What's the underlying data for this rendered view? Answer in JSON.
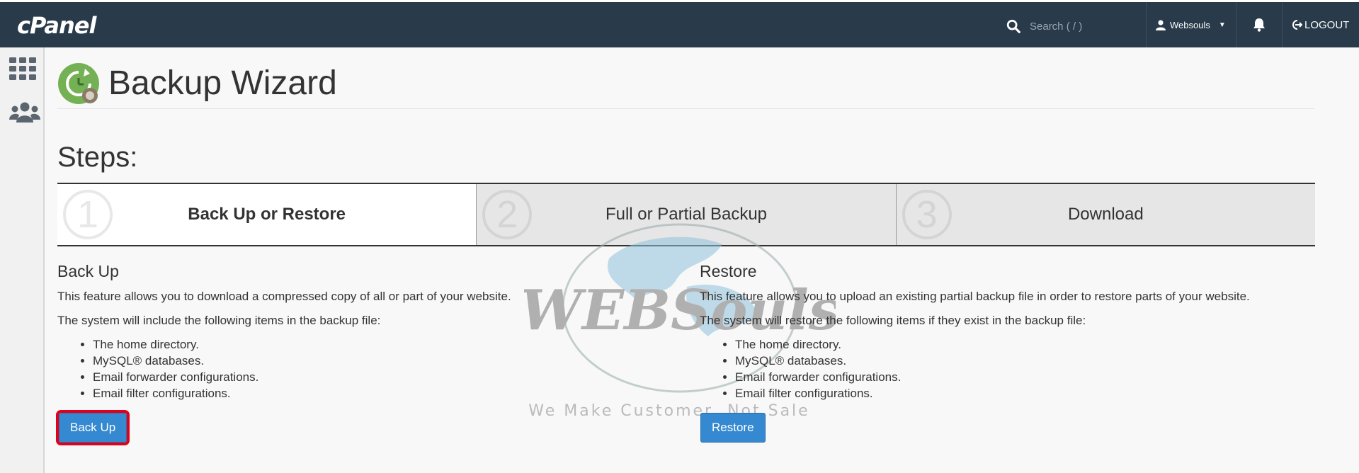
{
  "header": {
    "logo": "cPanel",
    "search_placeholder": "Search ( / )",
    "username": "Websouls",
    "logout_label": "LOGOUT"
  },
  "page": {
    "title": "Backup Wizard"
  },
  "steps": {
    "heading": "Steps:",
    "items": [
      {
        "number": "1",
        "label": "Back Up or Restore"
      },
      {
        "number": "2",
        "label": "Full or Partial Backup"
      },
      {
        "number": "3",
        "label": "Download"
      }
    ]
  },
  "backup": {
    "title": "Back Up",
    "desc": "This feature allows you to download a compressed copy of all or part of your website.",
    "includes_intro": "The system will include the following items in the backup file:",
    "items": [
      "The home directory.",
      "MySQL® databases.",
      "Email forwarder configurations.",
      "Email filter configurations."
    ],
    "button_label": "Back Up"
  },
  "restore": {
    "title": "Restore",
    "desc": "This feature allows you to upload an existing partial backup file in order to restore parts of your website.",
    "includes_intro": "The system will restore the following items if they exist in the backup file:",
    "items": [
      "The home directory.",
      "MySQL® databases.",
      "Email forwarder configurations.",
      "Email filter configurations."
    ],
    "button_label": "Restore"
  },
  "watermark": {
    "brand": "WEBSouls",
    "tagline": "We Make Customer, Not Sale"
  },
  "colors": {
    "topbar": "#293a4a",
    "button": "#3589d0",
    "highlight": "#e1001a"
  }
}
